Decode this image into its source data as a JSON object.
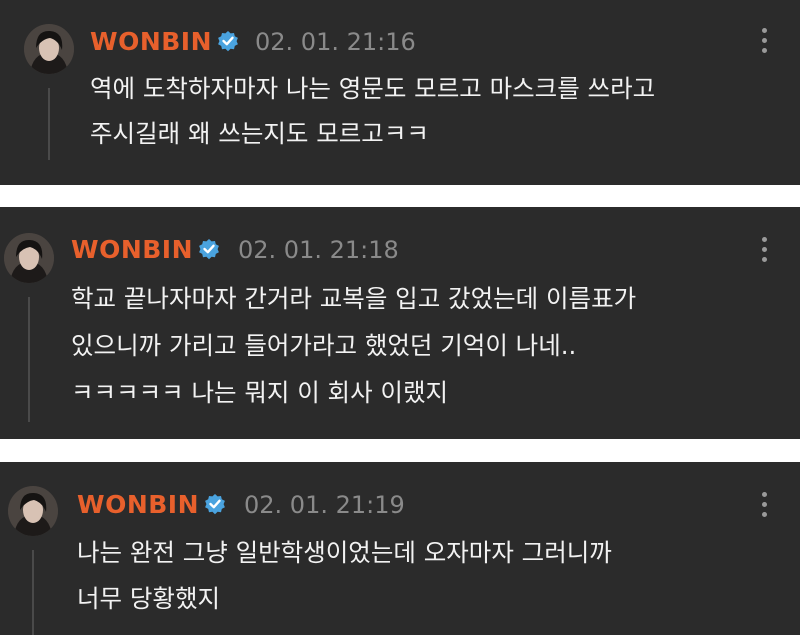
{
  "posts": [
    {
      "author": "WONBIN",
      "time": "02. 01. 21:16",
      "lines": [
        "역에 도착하자마자 나는 영문도 모르고 마스크를 쓰라고",
        "주시길래 왜 쓰는지도 모르고ㅋㅋ"
      ]
    },
    {
      "author": "WONBIN",
      "time": "02. 01. 21:18",
      "lines": [
        "학교 끝나자마자 간거라 교복을 입고 갔었는데 이름표가",
        "있으니까 가리고 들어가라고 했었던 기억이 나네..",
        "ㅋㅋㅋㅋㅋ 나는 뭐지 이 회사 이랬지"
      ]
    },
    {
      "author": "WONBIN",
      "time": "02. 01. 21:19",
      "lines": [
        "나는 완전 그냥 일반학생이었는데 오자마자 그러니까",
        "너무 당황했지"
      ]
    }
  ],
  "colors": {
    "author": "#e8602c",
    "badge": "#4aa3df",
    "card_bg": "#2b2b2b",
    "time": "#8a8a8a"
  },
  "icons": {
    "badge": "verified-check-icon",
    "menu": "more-vertical-icon"
  }
}
